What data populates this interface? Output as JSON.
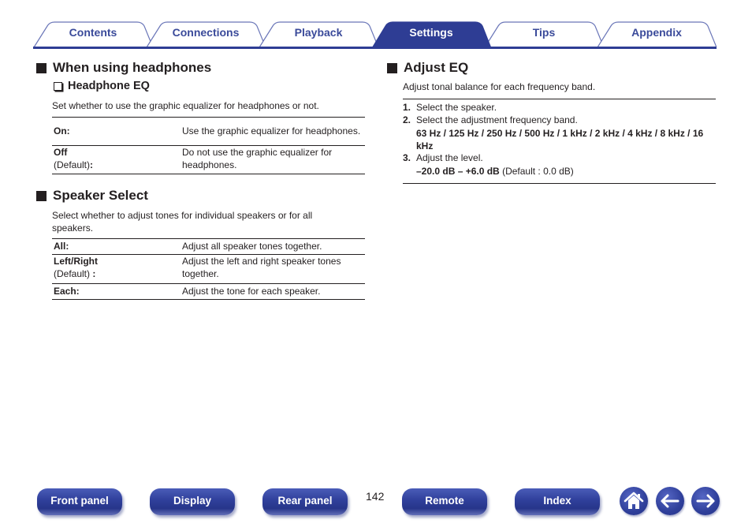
{
  "tabs": [
    {
      "label": "Contents",
      "active": false
    },
    {
      "label": "Connections",
      "active": false
    },
    {
      "label": "Playback",
      "active": false
    },
    {
      "label": "Settings",
      "active": true
    },
    {
      "label": "Tips",
      "active": false
    },
    {
      "label": "Appendix",
      "active": false
    }
  ],
  "colors": {
    "accent": "#2e3d94",
    "tab_text": "#3a4a9a",
    "text": "#231f20"
  },
  "left": {
    "headphones": {
      "title": "When using headphones",
      "subtitle": "Headphone EQ",
      "description": "Set whether to use the graphic equalizer for headphones or not.",
      "rows": [
        {
          "key": "On:",
          "key_default": "",
          "value": "Use the graphic equalizer for headphones."
        },
        {
          "key": "Off",
          "key_default": "(Default)",
          "key_suffix": ":",
          "value": "Do not use the graphic equalizer for headphones."
        }
      ]
    },
    "speaker_select": {
      "title": "Speaker Select",
      "description": "Select whether to adjust tones for individual speakers or for all speakers.",
      "rows": [
        {
          "key": "All:",
          "key_default": "",
          "value": "Adjust all speaker tones together."
        },
        {
          "key": "Left/Right",
          "key_default": "(Default)",
          "key_suffix": " :",
          "value": "Adjust the left and right speaker tones together."
        },
        {
          "key": "Each:",
          "key_default": "",
          "value": "Adjust the tone for each speaker."
        }
      ]
    }
  },
  "right": {
    "adjust_eq": {
      "title": "Adjust EQ",
      "description": "Adjust tonal balance for each frequency band.",
      "steps": [
        {
          "num": "1.",
          "text": "Select the speaker."
        },
        {
          "num": "2.",
          "text": "Select the adjustment frequency band.",
          "detail_bold": "63 Hz / 125 Hz / 250 Hz / 500 Hz / 1 kHz / 2 kHz / 4 kHz / 8 kHz / 16 kHz"
        },
        {
          "num": "3.",
          "text": "Adjust the level.",
          "detail_bold": "–20.0 dB – +6.0 dB",
          "detail_normal": " (Default : 0.0 dB)"
        }
      ]
    }
  },
  "footer": {
    "buttons": [
      "Front panel",
      "Display",
      "Rear panel",
      "Remote",
      "Index"
    ],
    "page_number": "142",
    "icons": [
      "home-icon",
      "back-arrow-icon",
      "forward-arrow-icon"
    ]
  }
}
